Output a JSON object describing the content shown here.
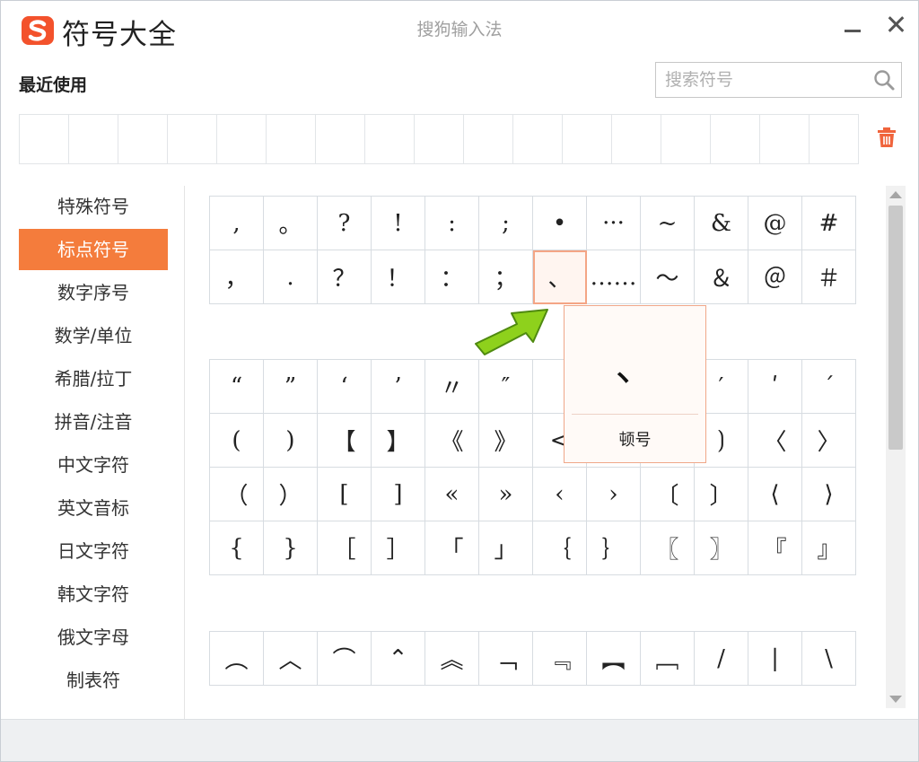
{
  "header": {
    "logo_icon": "sogou-s-logo",
    "title": "符号大全",
    "subtitle": "搜狗输入法",
    "controls": [
      "minimize-icon",
      "close-icon"
    ]
  },
  "recent": {
    "label": "最近使用",
    "slots": 17,
    "clear_icon": "trash-icon"
  },
  "search": {
    "placeholder": "搜索符号",
    "value": ""
  },
  "sidebar": {
    "selected_index": 1,
    "items": [
      {
        "label": "特殊符号"
      },
      {
        "label": "标点符号"
      },
      {
        "label": "数字序号"
      },
      {
        "label": "数学/单位"
      },
      {
        "label": "希腊/拉丁"
      },
      {
        "label": "拼音/注音"
      },
      {
        "label": "中文字符"
      },
      {
        "label": "英文音标"
      },
      {
        "label": "日文字符"
      },
      {
        "label": "韩文字符"
      },
      {
        "label": "俄文字母"
      },
      {
        "label": "制表符"
      }
    ]
  },
  "symbol_groups": [
    {
      "rows": [
        [
          ",",
          "。",
          "?",
          "!",
          ":",
          ";",
          "•",
          "···",
          "~",
          "&",
          "@",
          "#"
        ],
        [
          "，",
          ".",
          "？",
          "！",
          "：",
          "；",
          "、",
          "……",
          "～",
          "＆",
          "＠",
          "＃"
        ]
      ]
    },
    {
      "rows": [
        [
          "“",
          "”",
          "‘",
          "’",
          "〃",
          "″",
          "",
          "",
          "",
          "′",
          "ʹ",
          "ˊ"
        ],
        [
          "(",
          ")",
          "【",
          "】",
          "《",
          "》",
          "<",
          "",
          "",
          "⟯",
          "〈",
          "〉"
        ],
        [
          "（",
          "）",
          "[",
          "]",
          "«",
          "»",
          "‹",
          "›",
          "〔",
          "〕",
          "⟨",
          "⟩"
        ],
        [
          "{",
          "}",
          "［",
          "］",
          "「",
          "」",
          "｛",
          "｝",
          "〖",
          "〗",
          "『",
          "』"
        ]
      ]
    },
    {
      "rows": [
        [
          "︵",
          "︿",
          "⌒",
          "⌃",
          "︽",
          "﹁",
          "﹃",
          "︻",
          "﹇",
          "/",
          "|",
          "\\"
        ]
      ]
    }
  ],
  "highlighted": {
    "group": 0,
    "row": 1,
    "col": 6
  },
  "tooltip": {
    "symbol": "、",
    "name": "顿号"
  },
  "colors": {
    "accent": "#f47c3c",
    "arrow": "#8ed11c"
  }
}
